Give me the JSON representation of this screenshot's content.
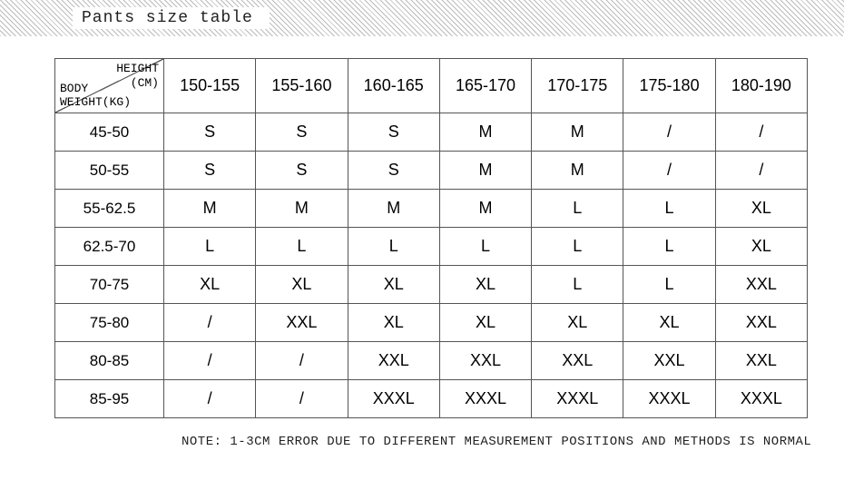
{
  "title": "Pants size table",
  "corner": {
    "top1": "HEIGHT",
    "top2": "(CM)",
    "bot1": "BODY",
    "bot2": "WEIGHT(KG)"
  },
  "col_headers": [
    "150-155",
    "155-160",
    "160-165",
    "165-170",
    "170-175",
    "175-180",
    "180-190"
  ],
  "rows": [
    {
      "label": "45-50",
      "cells": [
        "S",
        "S",
        "S",
        "M",
        "M",
        "/",
        "/"
      ]
    },
    {
      "label": "50-55",
      "cells": [
        "S",
        "S",
        "S",
        "M",
        "M",
        "/",
        "/"
      ]
    },
    {
      "label": "55-62.5",
      "cells": [
        "M",
        "M",
        "M",
        "M",
        "L",
        "L",
        "XL"
      ]
    },
    {
      "label": "62.5-70",
      "cells": [
        "L",
        "L",
        "L",
        "L",
        "L",
        "L",
        "XL"
      ]
    },
    {
      "label": "70-75",
      "cells": [
        "XL",
        "XL",
        "XL",
        "XL",
        "L",
        "L",
        "XXL"
      ]
    },
    {
      "label": "75-80",
      "cells": [
        "/",
        "XXL",
        "XL",
        "XL",
        "XL",
        "XL",
        "XXL"
      ]
    },
    {
      "label": "80-85",
      "cells": [
        "/",
        "/",
        "XXL",
        "XXL",
        "XXL",
        "XXL",
        "XXL"
      ]
    },
    {
      "label": "85-95",
      "cells": [
        "/",
        "/",
        "XXXL",
        "XXXL",
        "XXXL",
        "XXXL",
        "XXXL"
      ]
    }
  ],
  "note": "NOTE: 1-3CM ERROR DUE TO DIFFERENT MEASUREMENT POSITIONS AND METHODS IS NORMAL",
  "chart_data": {
    "type": "table",
    "title": "Pants size table",
    "x_axis": "HEIGHT (CM)",
    "y_axis": "BODY WEIGHT(KG)",
    "columns": [
      "150-155",
      "155-160",
      "160-165",
      "165-170",
      "170-175",
      "175-180",
      "180-190"
    ],
    "rows": [
      "45-50",
      "50-55",
      "55-62.5",
      "62.5-70",
      "70-75",
      "75-80",
      "80-85",
      "85-95"
    ],
    "values": [
      [
        "S",
        "S",
        "S",
        "M",
        "M",
        "/",
        "/"
      ],
      [
        "S",
        "S",
        "S",
        "M",
        "M",
        "/",
        "/"
      ],
      [
        "M",
        "M",
        "M",
        "M",
        "L",
        "L",
        "XL"
      ],
      [
        "L",
        "L",
        "L",
        "L",
        "L",
        "L",
        "XL"
      ],
      [
        "XL",
        "XL",
        "XL",
        "XL",
        "L",
        "L",
        "XXL"
      ],
      [
        "/",
        "XXL",
        "XL",
        "XL",
        "XL",
        "XL",
        "XXL"
      ],
      [
        "/",
        "/",
        "XXL",
        "XXL",
        "XXL",
        "XXL",
        "XXL"
      ],
      [
        "/",
        "/",
        "XXXL",
        "XXXL",
        "XXXL",
        "XXXL",
        "XXXL"
      ]
    ]
  }
}
